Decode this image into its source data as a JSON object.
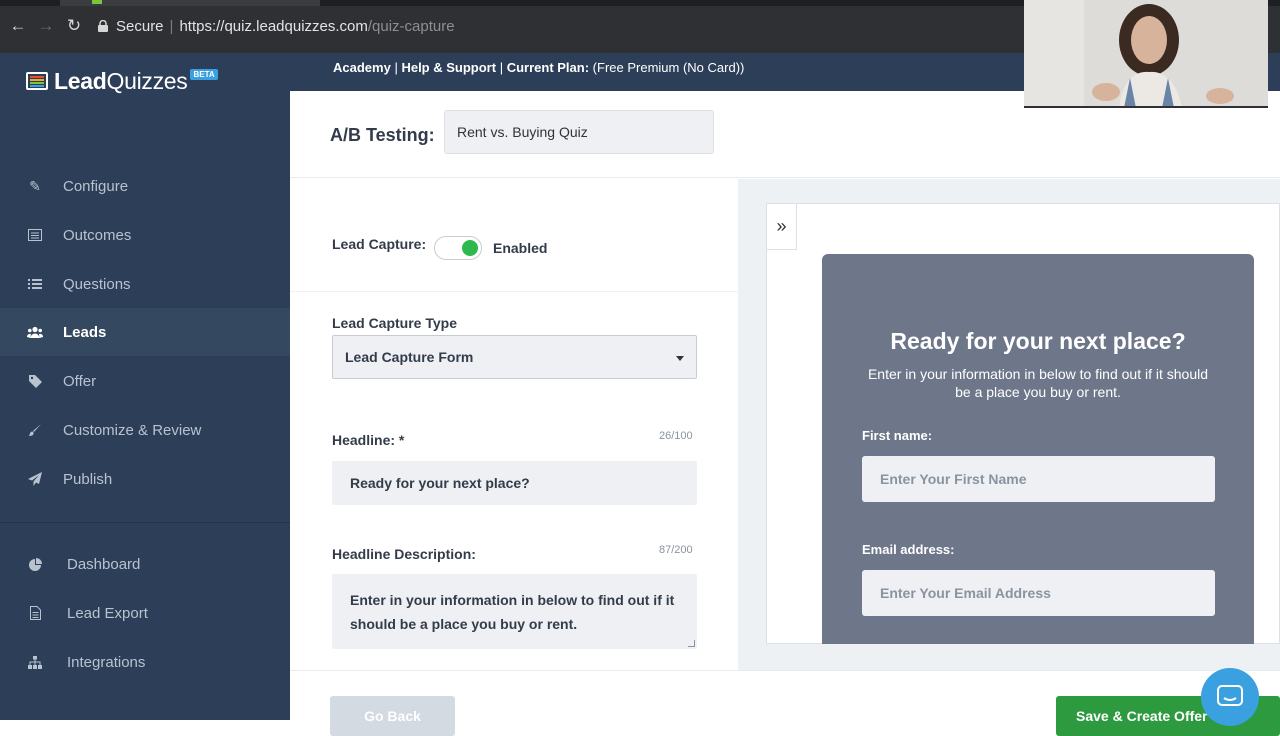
{
  "browser": {
    "secure_label": "Secure",
    "url_host": "https://quiz.leadquizzes.com",
    "url_path": "/quiz-capture"
  },
  "brand": {
    "logo_text_bold": "Lead",
    "logo_text_light": "Quizzes",
    "badge": "BETA",
    "colors": {
      "sidebar": "#2c3e58",
      "accent_green": "#2eb84d",
      "save_green": "#2d9a3f",
      "preview_card": "#6d7789",
      "chat_blue": "#3aa0e0"
    }
  },
  "sidebar": {
    "items": [
      {
        "label": "Configure",
        "icon": "edit-icon"
      },
      {
        "label": "Outcomes",
        "icon": "list-alt-icon"
      },
      {
        "label": "Questions",
        "icon": "list-icon"
      },
      {
        "label": "Leads",
        "icon": "users-icon",
        "active": true
      },
      {
        "label": "Offer",
        "icon": "tag-icon"
      },
      {
        "label": "Customize & Review",
        "icon": "paintbrush-icon"
      },
      {
        "label": "Publish",
        "icon": "paper-plane-icon"
      }
    ],
    "lower_items": [
      {
        "label": "Dashboard",
        "icon": "pie-chart-icon"
      },
      {
        "label": "Lead Export",
        "icon": "file-icon"
      },
      {
        "label": "Integrations",
        "icon": "sitemap-icon"
      }
    ]
  },
  "topbar": {
    "academy": "Academy",
    "sep": "|",
    "help": "Help & Support",
    "plan_label": "Current Plan:",
    "plan_value": "(Free Premium (No Card))"
  },
  "ab_testing": {
    "label": "A/B Testing:",
    "selected": "Rent vs. Buying Quiz"
  },
  "lead_capture": {
    "label": "Lead Capture:",
    "toggle_on": true,
    "status": "Enabled",
    "type_label": "Lead Capture Type",
    "type_value": "Lead Capture Form",
    "headline_label": "Headline: *",
    "headline_counter": "26/100",
    "headline_value": "Ready for your next place?",
    "desc_label": "Headline Description:",
    "desc_counter": "87/200",
    "desc_value": "Enter in your information in below to find out if it should be a place you buy or rent."
  },
  "preview": {
    "collapse_glyph": "»",
    "title": "Ready for your next place?",
    "description": "Enter in your information in below to find out if it should be a place you buy or rent.",
    "first_name_label": "First name:",
    "first_name_placeholder": "Enter Your First Name",
    "email_label": "Email address:",
    "email_placeholder": "Enter Your Email Address"
  },
  "footer": {
    "go_back": "Go Back",
    "save": "Save & Create Offer"
  }
}
